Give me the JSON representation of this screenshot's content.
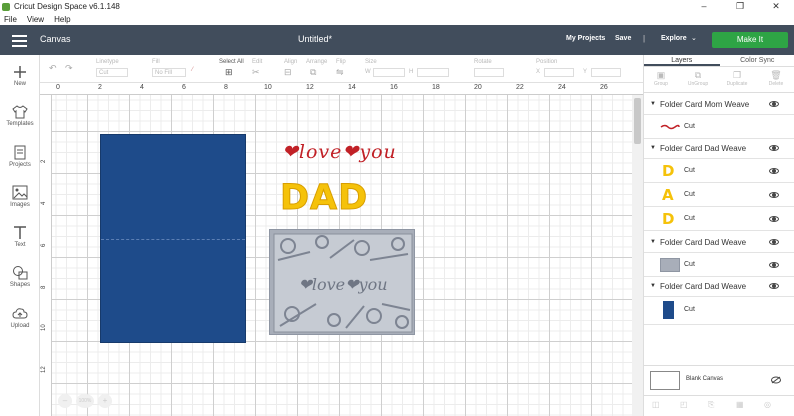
{
  "app": {
    "title": "Cricut Design Space  v6.1.148"
  },
  "window_controls": {
    "minimize": "–",
    "maximize": "❐",
    "close": "✕"
  },
  "menu": [
    "File",
    "View",
    "Help"
  ],
  "header": {
    "section": "Canvas",
    "document_title": "Untitled*",
    "my_projects": "My Projects",
    "save": "Save",
    "separator": "|",
    "explore": "Explore",
    "explore_chevron": "⌄",
    "make_it": "Make It",
    "make_it_color": "#2ea445",
    "header_color": "#414d5c"
  },
  "left_tools": [
    {
      "label": "New",
      "icon": "plus-icon"
    },
    {
      "label": "Templates",
      "icon": "shirt-icon"
    },
    {
      "label": "Projects",
      "icon": "projects-icon"
    },
    {
      "label": "Images",
      "icon": "image-icon"
    },
    {
      "label": "Text",
      "icon": "text-icon"
    },
    {
      "label": "Shapes",
      "icon": "shapes-icon"
    },
    {
      "label": "Upload",
      "icon": "upload-icon"
    }
  ],
  "edit_toolbar": {
    "linetype_label": "Linetype",
    "linetype_value": "Cut",
    "fill_label": "Fill",
    "fill_value": "No Fill",
    "select_all": "Select All",
    "edit": "Edit",
    "align": "Align",
    "arrange": "Arrange",
    "flip": "Flip",
    "size": "Size",
    "size_w": "W",
    "size_h": "H",
    "rotate": "Rotate",
    "position": "Position",
    "position_x": "X",
    "position_y": "Y"
  },
  "rulers": {
    "top": [
      "0",
      "2",
      "4",
      "6",
      "8",
      "10",
      "12",
      "14",
      "16",
      "18",
      "20",
      "22",
      "24",
      "26"
    ],
    "left": [
      "2",
      "4",
      "6",
      "8",
      "10",
      "12"
    ]
  },
  "canvas_items": {
    "love_text": "❤love❤you",
    "love_color": "#c12127",
    "dad_text": "DAD",
    "dad_color": "#f5c20a",
    "card_blue": "#1e4b8a",
    "card_gray": "#a8aeb9",
    "weave_script": "❤love❤you"
  },
  "zoom_controls": [
    "–",
    "100%",
    "+"
  ],
  "right_panel": {
    "tabs": [
      "Layers",
      "Color Sync"
    ],
    "tools": [
      "Group",
      "UnGroup",
      "Duplicate",
      "Delete"
    ],
    "groups": [
      {
        "name": "Folder Card Mom Weave",
        "layers": [
          {
            "label": "Cut",
            "thumb": "red-script"
          }
        ]
      },
      {
        "name": "Folder Card Dad Weave",
        "layers": [
          {
            "label": "Cut",
            "thumb": "D"
          },
          {
            "label": "Cut",
            "thumb": "A"
          },
          {
            "label": "Cut",
            "thumb": "D"
          }
        ]
      },
      {
        "name": "Folder Card Dad Weave",
        "layers": [
          {
            "label": "Cut",
            "thumb": "gray-weave"
          }
        ]
      },
      {
        "name": "Folder Card Dad Weave",
        "layers": [
          {
            "label": "Cut",
            "thumb": "blue-card"
          }
        ]
      }
    ],
    "blank_canvas": "Blank Canvas"
  }
}
